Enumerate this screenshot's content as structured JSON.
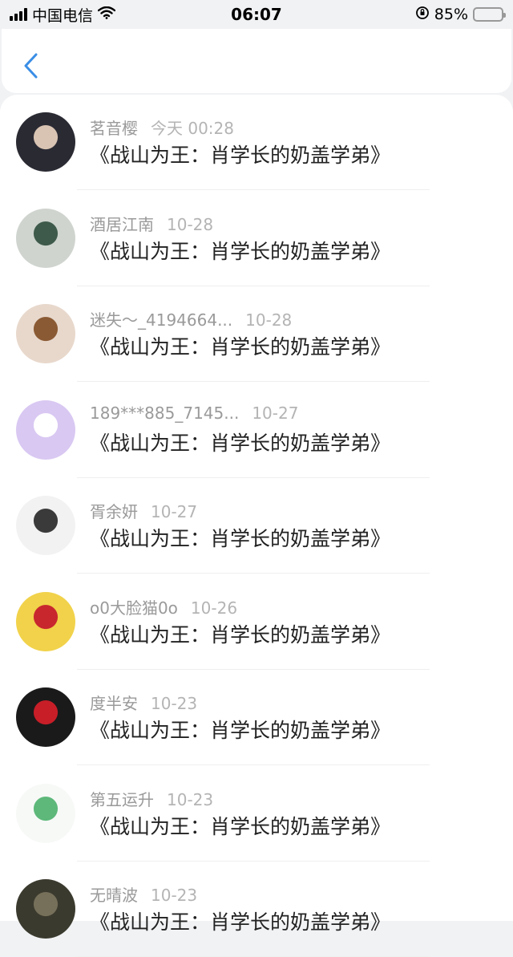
{
  "status_bar": {
    "carrier": "中国电信",
    "time": "06:07",
    "battery": "85%",
    "battery_level": 0.85
  },
  "header": {
    "back_icon": "chevron-left-icon",
    "accent_color": "#3a8ee6"
  },
  "items": [
    {
      "name": "茗音樱",
      "time": "今天 00:28",
      "title": "《战山为王：肖学长的奶盖学弟》",
      "avatar_colors": [
        "#2a2a33",
        "#d9c4b3"
      ]
    },
    {
      "name": "酒居江南",
      "time": "10-28",
      "title": "《战山为王：肖学长的奶盖学弟》",
      "avatar_colors": [
        "#cfd4cf",
        "#3e5a4a"
      ]
    },
    {
      "name": "迷失～_4194664...",
      "time": "10-28",
      "title": "《战山为王：肖学长的奶盖学弟》",
      "avatar_colors": [
        "#e8d8cc",
        "#8a5a34"
      ]
    },
    {
      "name": "189***885_7145...",
      "time": "10-27",
      "title": "《战山为王：肖学长的奶盖学弟》",
      "avatar_colors": [
        "#d9c8f2",
        "#ffffff"
      ]
    },
    {
      "name": "胥余妍",
      "time": "10-27",
      "title": "《战山为王：肖学长的奶盖学弟》",
      "avatar_colors": [
        "#f2f2f2",
        "#3a3a3a"
      ]
    },
    {
      "name": "o0大脸猫0o",
      "time": "10-26",
      "title": "《战山为王：肖学长的奶盖学弟》",
      "avatar_colors": [
        "#f1d24a",
        "#c8272e"
      ]
    },
    {
      "name": "度半安",
      "time": "10-23",
      "title": "《战山为王：肖学长的奶盖学弟》",
      "avatar_colors": [
        "#1a1a1a",
        "#c81e28"
      ]
    },
    {
      "name": "第五运升",
      "time": "10-23",
      "title": "《战山为王：肖学长的奶盖学弟》",
      "avatar_colors": [
        "#f7f9f7",
        "#5db87a"
      ]
    },
    {
      "name": "无晴波",
      "time": "10-23",
      "title": "《战山为王：肖学长的奶盖学弟》",
      "avatar_colors": [
        "#3b3a2e",
        "#76705a"
      ]
    }
  ]
}
